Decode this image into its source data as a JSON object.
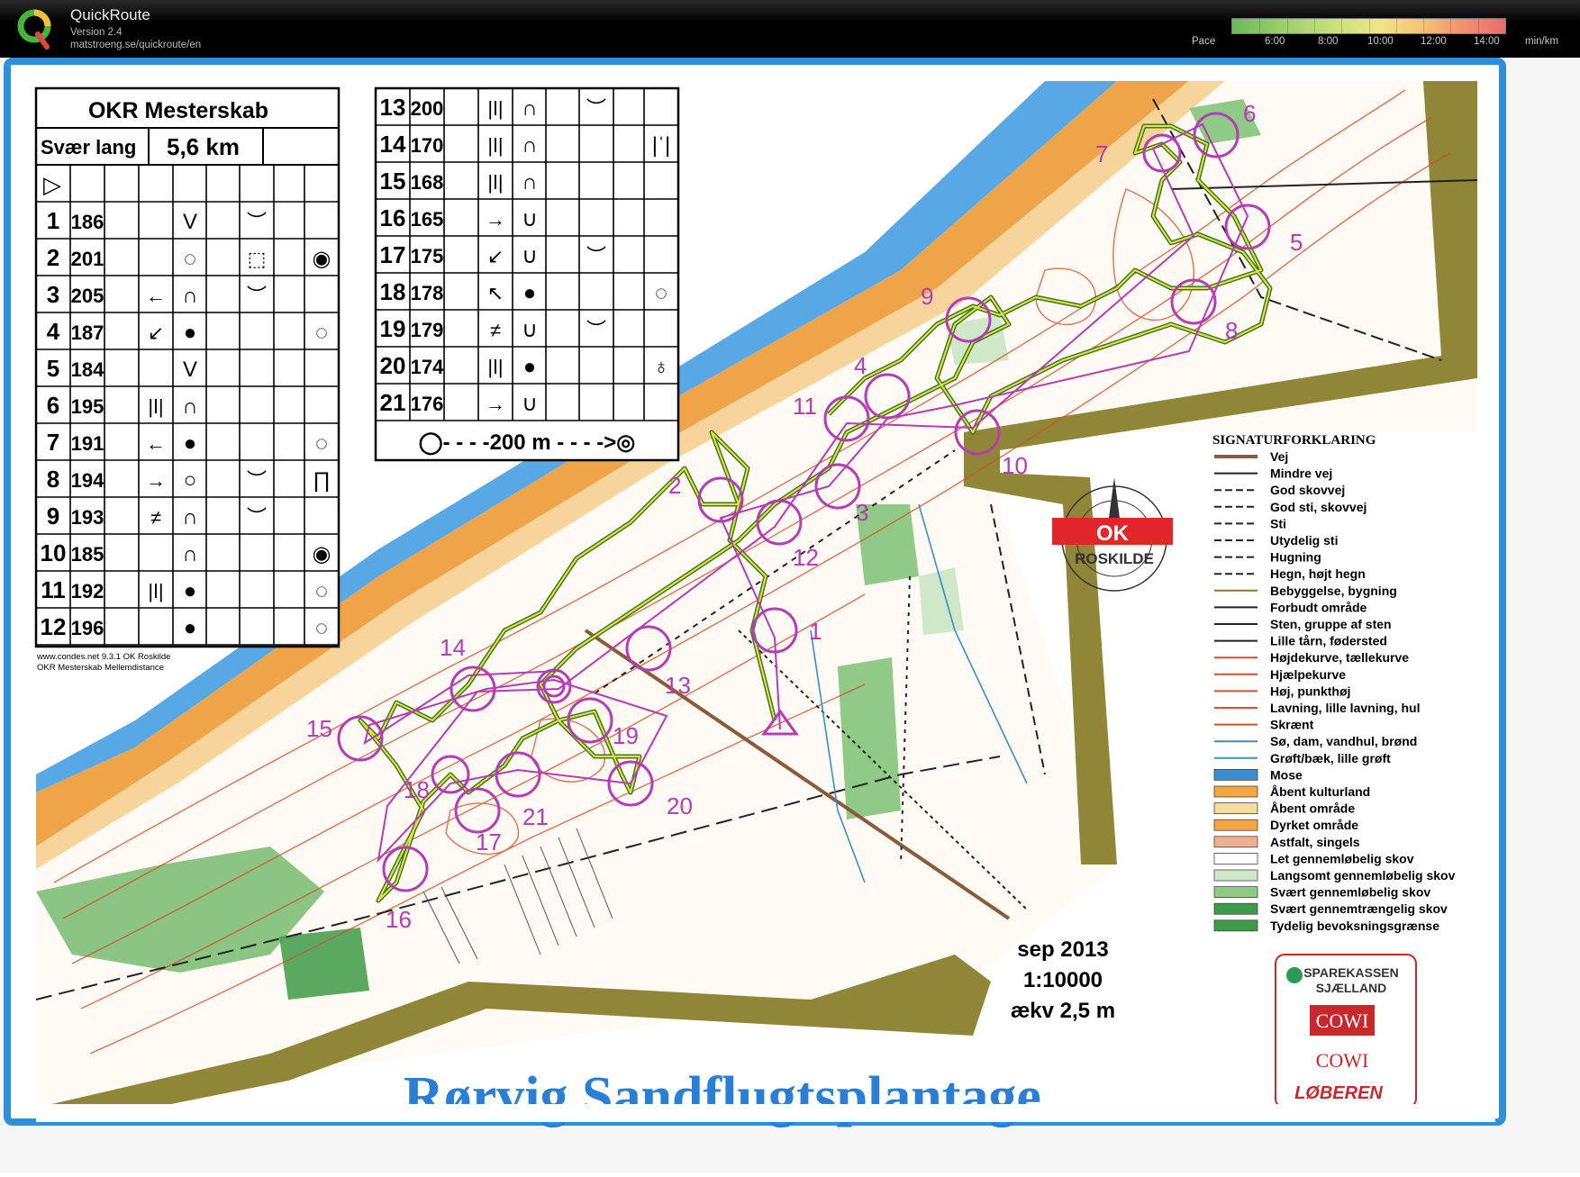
{
  "app": {
    "title": "QuickRoute",
    "version": "Version 2.4",
    "url": "matstroeng.se/quickroute/en",
    "logo_letter": "Q"
  },
  "pace": {
    "label": "Pace",
    "ticks": [
      "6:00",
      "8:00",
      "10:00",
      "12:00",
      "14:00"
    ],
    "unit": "min/km",
    "colors": [
      "#6aba5c",
      "#cfe37b",
      "#f0e483",
      "#f6c173",
      "#e96d6a"
    ]
  },
  "description": {
    "title": "OKR Mesterskab",
    "class": "Svær lang",
    "length": "5,6 km",
    "start": "▷",
    "rows": [
      {
        "n": "1",
        "code": "186",
        "c3": "",
        "c4": "V",
        "c6": "︶",
        "c8": ""
      },
      {
        "n": "2",
        "code": "201",
        "c3": "",
        "c4": "◌",
        "c6": "⬚",
        "c8": "◉"
      },
      {
        "n": "3",
        "code": "205",
        "c3": "←",
        "c4": "∩",
        "c6": "︶",
        "c8": ""
      },
      {
        "n": "4",
        "code": "187",
        "c3": "↙",
        "c4": "●",
        "c6": "",
        "c8": "◌"
      },
      {
        "n": "5",
        "code": "184",
        "c3": "",
        "c4": "V",
        "c6": "",
        "c8": ""
      },
      {
        "n": "6",
        "code": "195",
        "c3": "|ǀ|",
        "c4": "∩",
        "c6": "",
        "c8": ""
      },
      {
        "n": "7",
        "code": "191",
        "c3": "←",
        "c4": "●",
        "c6": "",
        "c8": "◌"
      },
      {
        "n": "8",
        "code": "194",
        "c3": "→",
        "c4": "○",
        "c6": "︶",
        "c8": "∏"
      },
      {
        "n": "9",
        "code": "193",
        "c3": "≠",
        "c4": "∩",
        "c6": "︶",
        "c8": ""
      },
      {
        "n": "10",
        "code": "185",
        "c3": "",
        "c4": "∩",
        "c6": "",
        "c8": "◉"
      },
      {
        "n": "11",
        "code": "192",
        "c3": "|ǀ|",
        "c4": "●",
        "c6": "",
        "c8": "◌"
      },
      {
        "n": "12",
        "code": "196",
        "c3": "",
        "c4": "●",
        "c6": "",
        "c8": "◌"
      },
      {
        "n": "13",
        "code": "200",
        "c3": "|ǀ|",
        "c4": "∩",
        "c6": "︶",
        "c8": ""
      },
      {
        "n": "14",
        "code": "170",
        "c3": "|ǀ|",
        "c4": "∩",
        "c6": "",
        "c8": "|ˈ|"
      },
      {
        "n": "15",
        "code": "168",
        "c3": "|ǀ|",
        "c4": "∩",
        "c6": "",
        "c8": ""
      },
      {
        "n": "16",
        "code": "165",
        "c3": "→",
        "c4": "∪",
        "c6": "",
        "c8": ""
      },
      {
        "n": "17",
        "code": "175",
        "c3": "↙",
        "c4": "∪",
        "c6": "︶",
        "c8": ""
      },
      {
        "n": "18",
        "code": "178",
        "c3": "↖",
        "c4": "●",
        "c6": "",
        "c8": "◌"
      },
      {
        "n": "19",
        "code": "179",
        "c3": "≠",
        "c4": "∪",
        "c6": "︶",
        "c8": ""
      },
      {
        "n": "20",
        "code": "174",
        "c3": "|ǀ|",
        "c4": "●",
        "c6": "",
        "c8": "♁"
      },
      {
        "n": "21",
        "code": "176",
        "c3": "→",
        "c4": "∪",
        "c6": "",
        "c8": ""
      }
    ],
    "finish": "◯- - - -200 m - - - ->◎",
    "footer1": "www.condes.net 9.3.1 OK Roskilde",
    "footer2": "OKR Mesterskab Mellemdistance"
  },
  "legend": {
    "title": "SIGNATURFORKLARING",
    "items": [
      {
        "label": "Vej",
        "color": "#8a5a3a"
      },
      {
        "label": "Mindre vej",
        "color": "#222"
      },
      {
        "label": "God skovvej",
        "color": "#222"
      },
      {
        "label": "God sti, skovvej",
        "color": "#222"
      },
      {
        "label": "Sti",
        "color": "#222"
      },
      {
        "label": "Utydelig sti",
        "color": "#222"
      },
      {
        "label": "Hugning",
        "color": "#222"
      },
      {
        "label": "Hegn, højt hegn",
        "color": "#222"
      },
      {
        "label": "Bebyggelse, bygning",
        "color": "#8a7a2c"
      },
      {
        "label": "Forbudt område",
        "color": "#222"
      },
      {
        "label": "Sten, gruppe af sten",
        "color": "#222"
      },
      {
        "label": "Lille tårn, føderstеd",
        "color": "#222"
      },
      {
        "label": "Højdekurve, tællekurve",
        "color": "#d4502a"
      },
      {
        "label": "Hjælpekurve",
        "color": "#d4502a"
      },
      {
        "label": "Høj, punkthøj",
        "color": "#d4502a"
      },
      {
        "label": "Lavning, lille lavning, hul",
        "color": "#d4502a"
      },
      {
        "label": "Skrænt",
        "color": "#d4502a"
      },
      {
        "label": "Sø, dam, vandhul, brønd",
        "color": "#3a8dd0"
      },
      {
        "label": "Grøft/bæk, lille grøft",
        "color": "#3a8dd0"
      },
      {
        "label": "Mose",
        "color": "#3a8dd0"
      },
      {
        "label": "Åbent kulturland",
        "color": "#f4a640"
      },
      {
        "label": "Åbent område",
        "color": "#f7dd9a"
      },
      {
        "label": "Dyrket område",
        "color": "#f4a640"
      },
      {
        "label": "Astfalt, singels",
        "color": "#f0b090"
      },
      {
        "label": "Let gennemløbelig skov",
        "color": "#ffffff"
      },
      {
        "label": "Langsomt gennemløbelig skov",
        "color": "#cfe8c8"
      },
      {
        "label": "Svært gennemløbelig skov",
        "color": "#8fca86"
      },
      {
        "label": "Svært gennemtrængelig skov",
        "color": "#3e9a46"
      },
      {
        "label": "Tydelig bevoksningsgrænse",
        "color": "#3e9a46"
      }
    ]
  },
  "club_logo": {
    "text": "ROSKILDE",
    "badge": "OK"
  },
  "map_info": {
    "date": "sep 2013",
    "scale": "1:10000",
    "equidistance": "ækv 2,5 m"
  },
  "map_name": "Rørvig Sandflugtsplantage",
  "sponsors": {
    "line1": "SPAREKASSEN",
    "line2": "SJÆLLAND",
    "cowi1": "COWI",
    "cowi2": "COWI",
    "loberen": "LØBEREN"
  },
  "controls": [
    "1",
    "2",
    "3",
    "4",
    "5",
    "6",
    "7",
    "8",
    "9",
    "10",
    "11",
    "12",
    "13",
    "14",
    "15",
    "16",
    "17",
    "18",
    "19",
    "20",
    "21"
  ],
  "route_color": "#a8c832",
  "course_color": "#b43cb4"
}
